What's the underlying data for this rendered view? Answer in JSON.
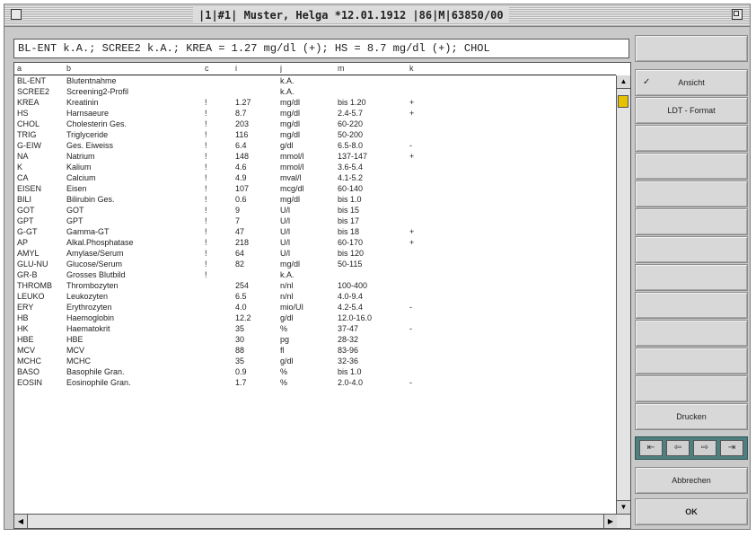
{
  "window": {
    "title": "|1|#1| Muster, Helga *12.01.1912 |86|M|63850/00"
  },
  "summary": {
    "value": "BL-ENT k.A.; SCREE2 k.A.; KREA = 1.27 mg/dl (+); HS = 8.7 mg/dl (+); CHOL"
  },
  "table": {
    "columns": [
      "a",
      "b",
      "c",
      "i",
      "j",
      "m",
      "k"
    ],
    "rows": [
      [
        "BL-ENT",
        "Blutentnahme",
        "",
        "",
        "k.A.",
        "",
        ""
      ],
      [
        "SCREE2",
        "Screening2-Profil",
        "",
        "",
        "k.A.",
        "",
        ""
      ],
      [
        "KREA",
        "Kreatinin",
        "!",
        "1.27",
        "mg/dl",
        "bis 1.20",
        "+"
      ],
      [
        "HS",
        "Harnsaeure",
        "!",
        "8.7",
        "mg/dl",
        "2.4-5.7",
        "+"
      ],
      [
        "CHOL",
        "Cholesterin Ges.",
        "!",
        "203",
        "mg/dl",
        "60-220",
        ""
      ],
      [
        "TRIG",
        "Triglyceride",
        "!",
        "116",
        "mg/dl",
        "50-200",
        ""
      ],
      [
        "G-EIW",
        "Ges. Eiweiss",
        "!",
        "6.4",
        "g/dl",
        "6.5-8.0",
        "-"
      ],
      [
        "NA",
        "Natrium",
        "!",
        "148",
        "mmol/l",
        "137-147",
        "+"
      ],
      [
        "K",
        "Kalium",
        "!",
        "4.6",
        "mmol/l",
        "3.6-5.4",
        ""
      ],
      [
        "CA",
        "Calcium",
        "!",
        "4.9",
        "mval/l",
        "4.1-5.2",
        ""
      ],
      [
        "EISEN",
        "Eisen",
        "!",
        "107",
        "mcg/dl",
        "60-140",
        ""
      ],
      [
        "BILI",
        "Bilirubin Ges.",
        "!",
        "0.6",
        "mg/dl",
        "bis 1.0",
        ""
      ],
      [
        "GOT",
        "GOT",
        "!",
        "9",
        "U/l",
        "bis 15",
        ""
      ],
      [
        "GPT",
        "GPT",
        "!",
        "7",
        "U/l",
        "bis 17",
        ""
      ],
      [
        "G-GT",
        "Gamma-GT",
        "!",
        "47",
        "U/l",
        "bis 18",
        "+"
      ],
      [
        "AP",
        "Alkal.Phosphatase",
        "!",
        "218",
        "U/l",
        "60-170",
        "+"
      ],
      [
        "AMYL",
        "Amylase/Serum",
        "!",
        "64",
        "U/l",
        "bis 120",
        ""
      ],
      [
        "GLU-NU",
        "Glucose/Serum",
        "!",
        "82",
        "mg/dl",
        "50-115",
        ""
      ],
      [
        "GR-B",
        "Grosses Blutbild",
        "!",
        "",
        "k.A.",
        "",
        ""
      ],
      [
        "THROMB",
        "Thrombozyten",
        "",
        "254",
        "n/nl",
        "100-400",
        ""
      ],
      [
        "LEUKO",
        "Leukozyten",
        "",
        "6.5",
        "n/nl",
        "4.0-9.4",
        ""
      ],
      [
        "ERY",
        "Erythrozyten",
        "",
        "4.0",
        "mio/UI",
        "4.2-5.4",
        "-"
      ],
      [
        "HB",
        "Haemoglobin",
        "",
        "12.2",
        "g/dl",
        "12.0-16.0",
        ""
      ],
      [
        "HK",
        "Haematokrit",
        "",
        "35",
        "%",
        "37-47",
        "-"
      ],
      [
        "HBE",
        "HBE",
        "",
        "30",
        "pg",
        "28-32",
        ""
      ],
      [
        "MCV",
        "MCV",
        "",
        "88",
        "fl",
        "83-96",
        ""
      ],
      [
        "MCHC",
        "MCHC",
        "",
        "35",
        "g/dl",
        "32-36",
        ""
      ],
      [
        "BASO",
        "Basophile Gran.",
        "",
        "0.9",
        "%",
        "bis 1.0",
        ""
      ],
      [
        "EOSIN",
        "Eosinophile Gran.",
        "",
        "1.7",
        "%",
        "2.0-4.0",
        "-"
      ]
    ]
  },
  "sidebar": {
    "buttons": [
      "",
      "Ansicht",
      "LDT - Format",
      "",
      "",
      "",
      "",
      "",
      "",
      "",
      "",
      "",
      "",
      "Drucken"
    ],
    "checked_index": 1,
    "nav": [
      "⇤",
      "⇦",
      "⇨",
      "⇥"
    ],
    "cancel_label": "Abbrechen",
    "ok_label": "OK"
  },
  "colors": {
    "thumb": "#e6c200",
    "nav_bar": "#4f7f7f"
  }
}
